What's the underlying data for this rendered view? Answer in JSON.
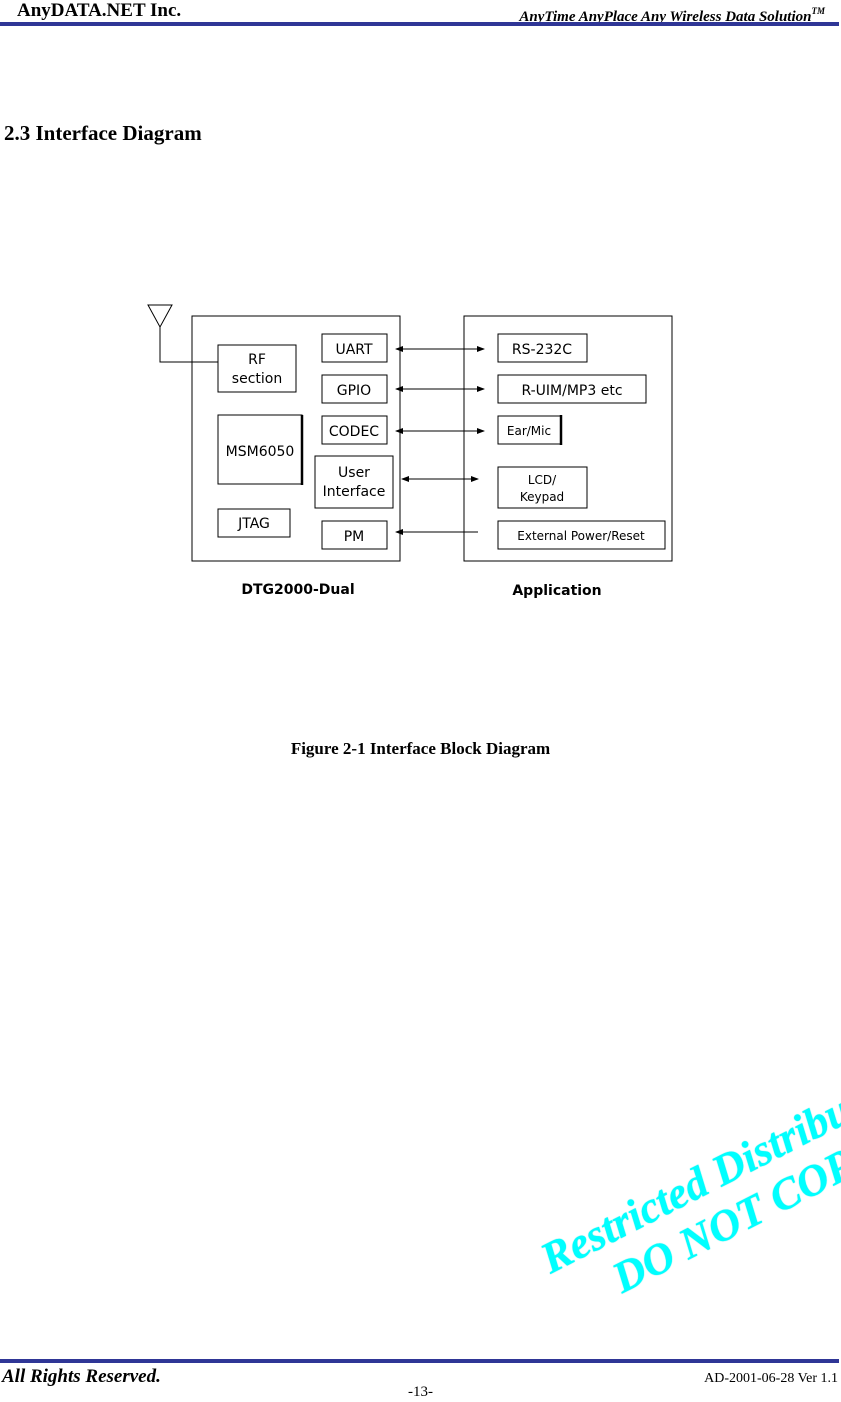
{
  "header": {
    "company": "AnyDATA.NET Inc.",
    "tagline": "AnyTime AnyPlace Any Wireless Data Solution",
    "tagline_mark": "TM",
    "rule_color": "#2f3696"
  },
  "section": {
    "title": "2.3 Interface Diagram"
  },
  "diagram": {
    "module": {
      "label": "DTG2000-Dual",
      "blocks": {
        "rf_line1": "RF",
        "rf_line2": "section",
        "msm": "MSM6050",
        "jtag": "JTAG",
        "uart": "UART",
        "gpio": "GPIO",
        "codec": "CODEC",
        "ui_line1": "User",
        "ui_line2": "Interface",
        "pm": "PM"
      }
    },
    "application": {
      "label": "Application",
      "blocks": {
        "rs232": "RS-232C",
        "ruim": "R-UIM/MP3 etc",
        "earmic": "Ear/Mic",
        "lcd_line1": "LCD/",
        "lcd_line2": "Keypad",
        "power": "External Power/Reset"
      }
    },
    "connections": [
      {
        "from": "UART",
        "to": "RS-232C",
        "direction": "bidirectional"
      },
      {
        "from": "GPIO",
        "to": "R-UIM/MP3 etc",
        "direction": "bidirectional"
      },
      {
        "from": "CODEC",
        "to": "Ear/Mic",
        "direction": "bidirectional"
      },
      {
        "from": "User Interface",
        "to": "LCD/Keypad",
        "direction": "bidirectional"
      },
      {
        "from": "External Power/Reset",
        "to": "PM",
        "direction": "to-module"
      }
    ]
  },
  "figure": {
    "caption": "Figure 2-1 Interface Block Diagram"
  },
  "watermark": {
    "line1": "Restricted Distribution",
    "line2": "DO NOT COPY",
    "color": "#00ffff"
  },
  "footer": {
    "rights": "All Rights Reserved.",
    "doc_id": "AD-2001-06-28 Ver 1.1",
    "page": "-13-"
  }
}
